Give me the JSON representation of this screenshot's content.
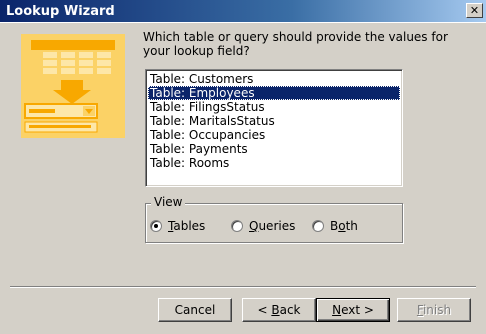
{
  "window": {
    "title": "Lookup Wizard",
    "close_glyph": "✕"
  },
  "prompt": "Which table or query should provide the values for your lookup field?",
  "list": {
    "items": [
      "Table: Customers",
      "Table: Employees",
      "Table: FilingsStatus",
      "Table: MaritalsStatus",
      "Table: Occupancies",
      "Table: Payments",
      "Table: Rooms"
    ],
    "selected": "Table: Employees"
  },
  "view": {
    "label": "View",
    "options": [
      {
        "pre": "",
        "key": "T",
        "post": "ables",
        "checked": true
      },
      {
        "pre": "",
        "key": "Q",
        "post": "ueries",
        "checked": false
      },
      {
        "pre": "B",
        "key": "o",
        "post": "th",
        "checked": false
      }
    ]
  },
  "buttons": {
    "cancel": "Cancel",
    "back": {
      "pre": "< ",
      "key": "B",
      "post": "ack"
    },
    "next": {
      "pre": "",
      "key": "N",
      "post": "ext >"
    },
    "finish": {
      "pre": "",
      "key": "F",
      "post": "inish"
    }
  },
  "colors": {
    "titlebar": "#0a246a",
    "selection": "#0a246a",
    "illustration": "#f8a800"
  }
}
